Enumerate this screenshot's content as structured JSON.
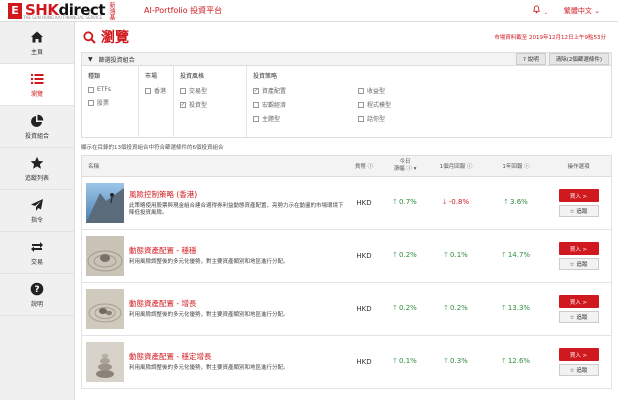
{
  "header": {
    "logo_box": "E",
    "logo_text_red": "SHK",
    "logo_text_dark": "direct",
    "logo_cn": "新鴻基",
    "logo_sub": "THE SUN HUNG KAI FINANCIAL SERVICE",
    "app_title": "AI-Portfolio 投資平台",
    "language": "繁體中文 ⌄"
  },
  "sidebar": {
    "items": [
      {
        "label": "主頁",
        "icon": "home-icon"
      },
      {
        "label": "瀏覽",
        "icon": "list-icon"
      },
      {
        "label": "投資組合",
        "icon": "pie-chart-icon"
      },
      {
        "label": "追蹤列表",
        "icon": "star-icon"
      },
      {
        "label": "指令",
        "icon": "paper-plane-icon"
      },
      {
        "label": "交易",
        "icon": "exchange-icon"
      },
      {
        "label": "說明",
        "icon": "question-icon"
      }
    ]
  },
  "page": {
    "title": "瀏覽",
    "price_note": "市場資料截至 2019年12月12日上午9點53分"
  },
  "filter": {
    "bar_label": "篩選投資組合",
    "explain_btn": "說明",
    "clear_btn": "清除(2個篩選條件)",
    "categories": {
      "title": "種類",
      "options": [
        {
          "label": "ETFs",
          "checked": false
        },
        {
          "label": "股票",
          "checked": false
        }
      ]
    },
    "market": {
      "title": "市場",
      "options": [
        {
          "label": "香港",
          "checked": false
        }
      ]
    },
    "style": {
      "title": "投資風格",
      "options": [
        {
          "label": "交易型",
          "checked": false
        },
        {
          "label": "投資型",
          "checked": true
        }
      ]
    },
    "strategy": {
      "title": "投資策略",
      "options": [
        {
          "label": "資產配置",
          "checked": true
        },
        {
          "label": "收益型",
          "checked": false
        },
        {
          "label": "宏觀經濟",
          "checked": false
        },
        {
          "label": "程式模型",
          "checked": false
        },
        {
          "label": "主題型",
          "checked": false
        },
        {
          "label": "話你型",
          "checked": false
        }
      ]
    }
  },
  "summary": "顯示在目錄的13個投資組合中符合篩選條件的6個投資組合",
  "table": {
    "headers": {
      "name": "名稱",
      "currency": "貨幣",
      "today_top": "今日",
      "today_bottom": "漲幅",
      "one_month": "1個月回報",
      "one_year": "1年回報",
      "actions": "操作選項"
    },
    "rows": [
      {
        "name": "風險控制策略 (香港)",
        "desc": "此策略使用股票與現金組合建合適得券利益動態資產配置，亮勢力示在動盪的市場環境下降低投資風險。",
        "currency": "HKD",
        "today": "0.7%",
        "today_dir": "up",
        "m1": "-0.8%",
        "m1_dir": "down",
        "y1": "3.6%",
        "y1_dir": "up",
        "buy": "買入 >",
        "track": "☆ 追蹤"
      },
      {
        "name": "動態資產配置 - 穩穩",
        "desc": "利用風險調整後的多元化優勢，對主要資產類別和地區進行分配。",
        "currency": "HKD",
        "today": "0.2%",
        "today_dir": "up",
        "m1": "0.1%",
        "m1_dir": "up",
        "y1": "14.7%",
        "y1_dir": "up",
        "buy": "買入 >",
        "track": "☆ 追蹤"
      },
      {
        "name": "動態資產配置 - 增長",
        "desc": "利用風險調整後的多元化優勢，對主要資產類別和地區進行分配。",
        "currency": "HKD",
        "today": "0.2%",
        "today_dir": "up",
        "m1": "0.2%",
        "m1_dir": "up",
        "y1": "13.3%",
        "y1_dir": "up",
        "buy": "買入 >",
        "track": "☆ 追蹤"
      },
      {
        "name": "動態資產配置 - 穩定增長",
        "desc": "利用風險調整後的多元化優勢，對主要資產類別和地區進行分配。",
        "currency": "HKD",
        "today": "0.1%",
        "today_dir": "up",
        "m1": "0.3%",
        "m1_dir": "up",
        "y1": "12.6%",
        "y1_dir": "up",
        "buy": "買入 >",
        "track": "☆ 追蹤"
      }
    ]
  },
  "colors": {
    "brand": "#d0191e",
    "up": "#2e8b3e",
    "down": "#d0191e"
  }
}
